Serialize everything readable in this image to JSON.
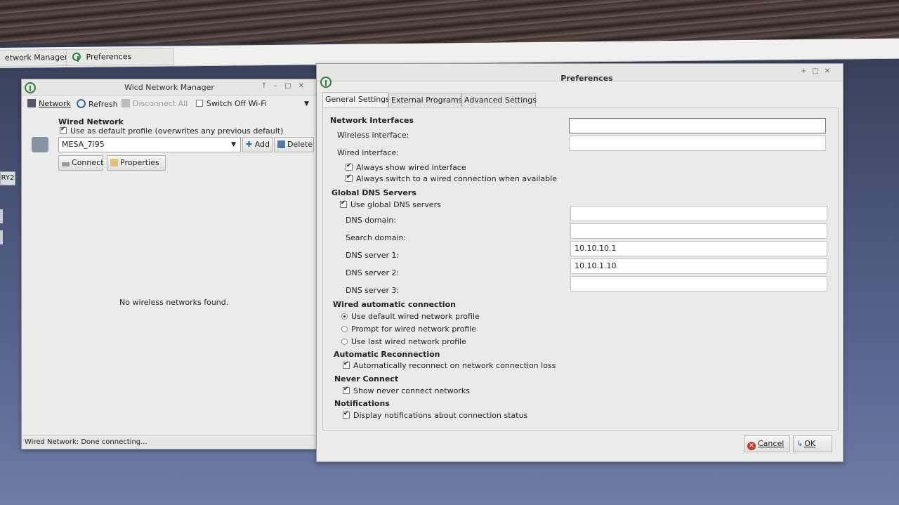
{
  "taskbar": {
    "items": [
      {
        "label": "etwork Manager"
      },
      {
        "label": "Preferences"
      }
    ]
  },
  "left_edge_tag": "RY2",
  "wicd": {
    "title": "Wicd Network Manager",
    "toolbar": {
      "network": "Network",
      "refresh": "Refresh",
      "disconnect_all": "Disconnect All",
      "switch_off_wifi": "Switch Off Wi-Fi"
    },
    "wired_heading": "Wired Network",
    "default_profile_label": "Use as default profile (overwrites any previous default)",
    "profile_value": "MESA_7i95",
    "add_label": "Add",
    "delete_label": "Delete",
    "connect_label": "Connect",
    "properties_label": "Properties",
    "no_networks": "No wireless networks found.",
    "status": "Wired Network: Done connecting..."
  },
  "prefs": {
    "title": "Preferences",
    "tabs": [
      "General Settings",
      "External Programs",
      "Advanced Settings"
    ],
    "sections": {
      "network_interfaces": "Network Interfaces",
      "global_dns": "Global DNS Servers",
      "wired_auto": "Wired automatic connection",
      "auto_reconnect": "Automatic Reconnection",
      "never_connect": "Never Connect",
      "notifications": "Notifications"
    },
    "wireless_interface_label": "Wireless interface:",
    "wireless_interface_value": "",
    "wired_interface_label": "Wired interface:",
    "wired_interface_value": "",
    "always_show_wired": "Always show wired interface",
    "always_switch_wired": "Always switch to a wired connection when available",
    "use_global_dns": "Use global DNS servers",
    "dns_domain_label": "DNS domain:",
    "dns_domain_value": "",
    "search_domain_label": "Search domain:",
    "search_domain_value": "",
    "dns1_label": "DNS server 1:",
    "dns1_value": "10.10.10.1",
    "dns2_label": "DNS server 2:",
    "dns2_value": "10.10.1.10",
    "dns3_label": "DNS server 3:",
    "dns3_value": "",
    "wired_options": [
      {
        "label": "Use default wired network profile",
        "selected": true
      },
      {
        "label": "Prompt for wired network profile",
        "selected": false
      },
      {
        "label": "Use last wired network profile",
        "selected": false
      }
    ],
    "auto_reconnect_label": "Automatically reconnect on network connection loss",
    "show_never_connect": "Show never connect networks",
    "display_notifications": "Display notifications about connection status",
    "cancel_label": "Cancel",
    "ok_label": "OK"
  },
  "icons": {
    "app": "wicd-antenna-icon",
    "network": "network-icon",
    "refresh": "refresh-icon",
    "disconnect": "disconnect-icon",
    "wired": "wired-connection-icon",
    "add": "plus-icon",
    "delete": "delete-icon",
    "connect": "plug-icon",
    "properties": "properties-icon",
    "cancel": "cancel-icon",
    "ok": "ok-icon"
  },
  "colors": {
    "window_bg": "#ececea",
    "accent_green": "#2f7d3a",
    "cancel_red": "#c0392b"
  }
}
